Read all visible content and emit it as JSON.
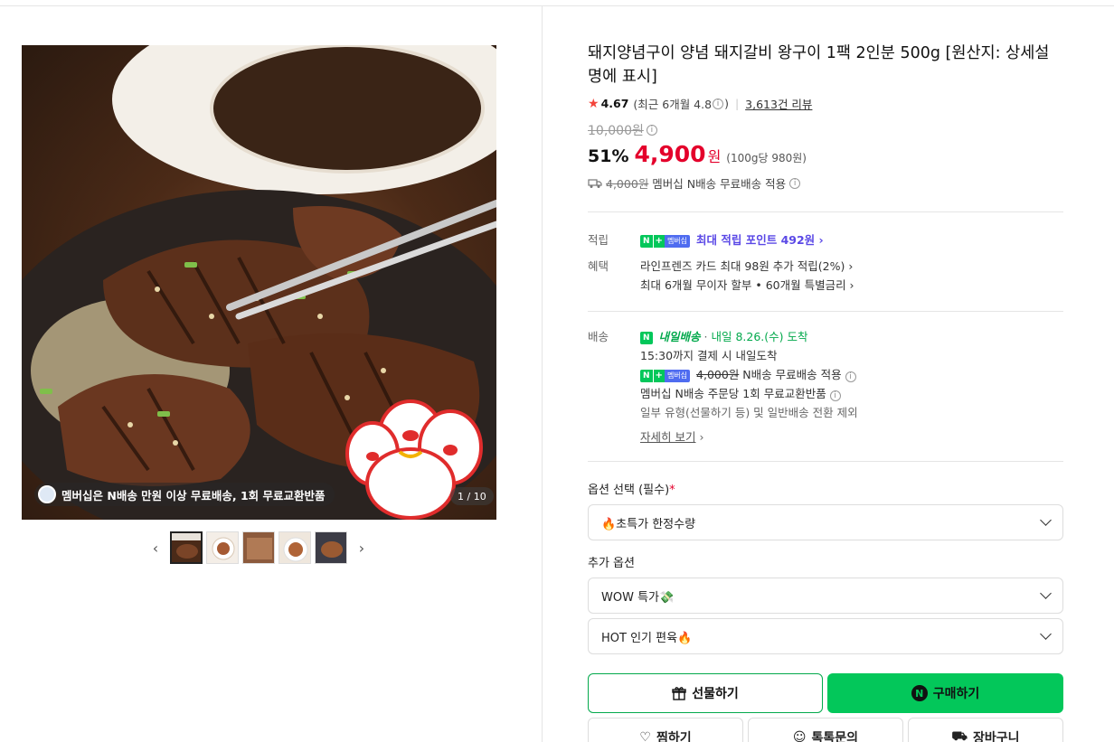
{
  "product": {
    "title": "돼지양념구이 양념 돼지갈비 왕구이 1팩 2인분 500g [원산지: 상세설명에 표시]",
    "rating": "4.67",
    "rating_recent": "(최근 6개월 4.8",
    "rating_recent_close": ")",
    "reviews": "3,613건 리뷰",
    "original_price": "10,000원",
    "discount": "51%",
    "price": "4,900",
    "price_unit": "원",
    "unit_price": "(100g당 980원)",
    "shipping_original": "4,000원",
    "shipping_text": "멤버십 N배송 무료배송 적용"
  },
  "gallery": {
    "promo_text": "멤버십은 N배송 만원 이상 무료배송, 1회 무료교환반품",
    "counter": "1 / 10",
    "thumb_count": 5,
    "active_thumb": 1
  },
  "benefits": {
    "points_label": "적립",
    "points_badge_n": "N",
    "points_badge_plus": "+",
    "points_badge_m": "멤버십",
    "points_text": "최대 적립 포인트 492원",
    "perks_label": "혜택",
    "perks": [
      "라인프렌즈 카드 최대 98원 추가 적립(2%)",
      "최대 6개월 무이자 할부 • 60개월 특별금리"
    ]
  },
  "delivery": {
    "label": "배송",
    "badge": "N",
    "badge_text": "내일배송",
    "arrival": "내일 8.26.(수) 도착",
    "cutoff": "15:30까지 결제 시 내일도착",
    "fee_original": "4,000원",
    "fee_text": "N배송 무료배송 적용",
    "exchange": "멤버십 N배송 주문당 1회 무료교환반품",
    "exclude": "일부 유형(선물하기 등) 및 일반배송 전환 제외",
    "more": "자세히 보기"
  },
  "options": {
    "required_label": "옵션 선택 (필수)",
    "required_mark": "*",
    "required_value": "🔥초특가 한정수량",
    "extra_label": "추가 옵션",
    "extra": [
      "WOW 특가💸",
      "HOT 인기 편육🔥"
    ]
  },
  "actions": {
    "gift": "선물하기",
    "buy": "구매하기",
    "buy_badge": "N",
    "wish": "찜하기",
    "talk": "톡톡문의",
    "cart": "장바구니"
  },
  "colors": {
    "accent_green": "#03c75a",
    "price_red": "#e4002b",
    "purple": "#5a48e6"
  }
}
